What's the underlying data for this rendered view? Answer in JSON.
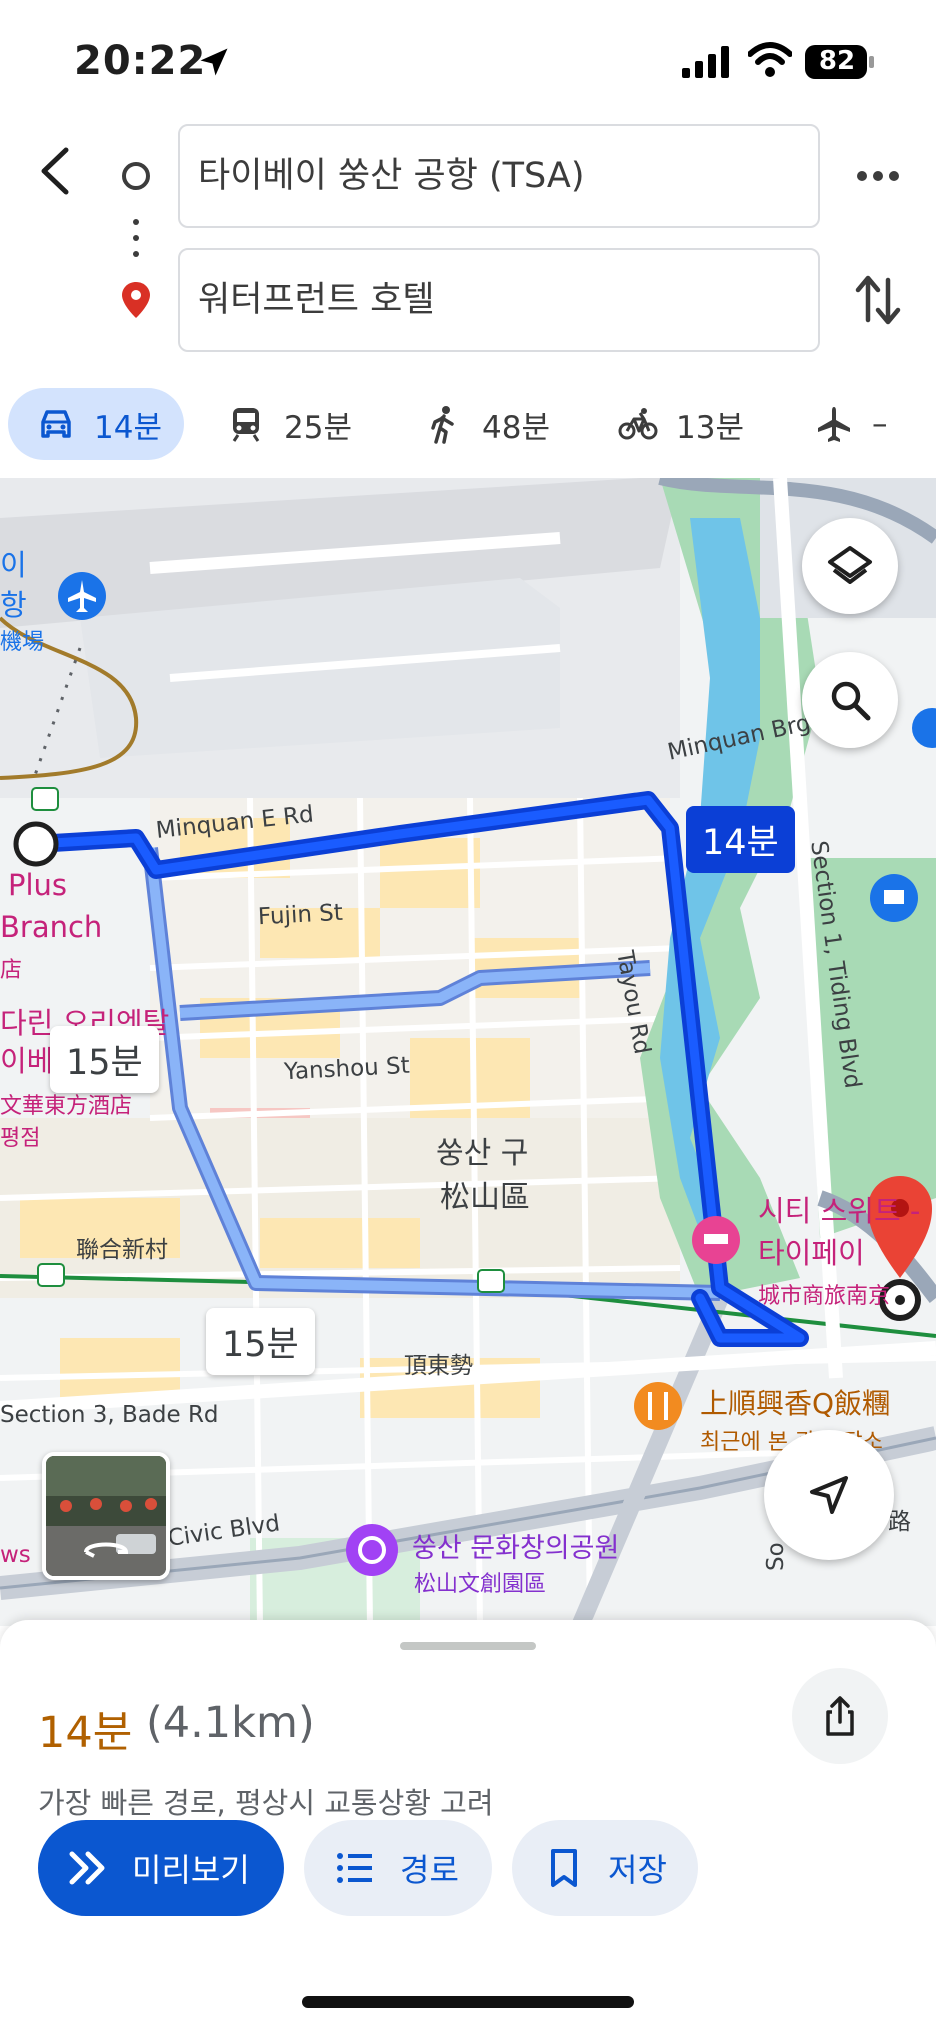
{
  "status_bar": {
    "time": "20:22",
    "battery": "82"
  },
  "search": {
    "origin": "타이베이 쑹산 공항 (TSA)",
    "destination": "워터프런트 호텔"
  },
  "modes": [
    {
      "name": "car",
      "label": "14분",
      "selected": true
    },
    {
      "name": "transit",
      "label": "25분"
    },
    {
      "name": "walk",
      "label": "48분"
    },
    {
      "name": "bike",
      "label": "13분"
    },
    {
      "name": "flight",
      "label": "–"
    }
  ],
  "map": {
    "labels": {
      "airport_name_1": "이",
      "airport_name_2": "항",
      "airport_cn": "機場",
      "plus": "Plus",
      "branch": "Branch",
      "branch_cn": "店",
      "mandarin_1": "다린 오리엔탈",
      "mandarin_2": "이베이",
      "mandarin_cn": "文華東方酒店",
      "mandarin_3": "평점",
      "minquan_e": "Minquan E Rd",
      "minquan_bridge": "Minquan Brg",
      "fujin": "Fujin St",
      "yanshou": "Yanshou St",
      "tayou": "Tayou Rd",
      "tiding": "Section 1, Tiding Blvd",
      "district_ko": "쑹산 구",
      "district_cn": "松山區",
      "lianhe": "聯合新村",
      "dingdong": "頂東勢",
      "bade": "Section 3, Bade Rd",
      "civic": "Civic Blvd",
      "ws": "ws",
      "so": "So",
      "lu": "路",
      "hotel_1": "시티 스위트 -",
      "hotel_2": "타이페이",
      "hotel_cn": "城市商旅南京",
      "restaurant": "上順興香Q飯糰",
      "restaurant_sub": "최근에 본 관심 장소",
      "park": "쑹산 문화창의공원",
      "park_cn": "松山文創園區"
    },
    "route_tags": {
      "primary": "14분",
      "alt_1": "15분",
      "alt_2": "15분"
    },
    "colors": {
      "route_primary": "#0b3fd6",
      "route_alt": "#8ab4f8",
      "park": "#a8dab5",
      "river": "#6fc4e8"
    }
  },
  "sheet": {
    "eta": "14분",
    "distance": "(4.1km)",
    "summary": "가장 빠른 경로, 평상시 교통상황 고려",
    "buttons": {
      "preview": "미리보기",
      "route": "경로",
      "save": "저장"
    }
  }
}
